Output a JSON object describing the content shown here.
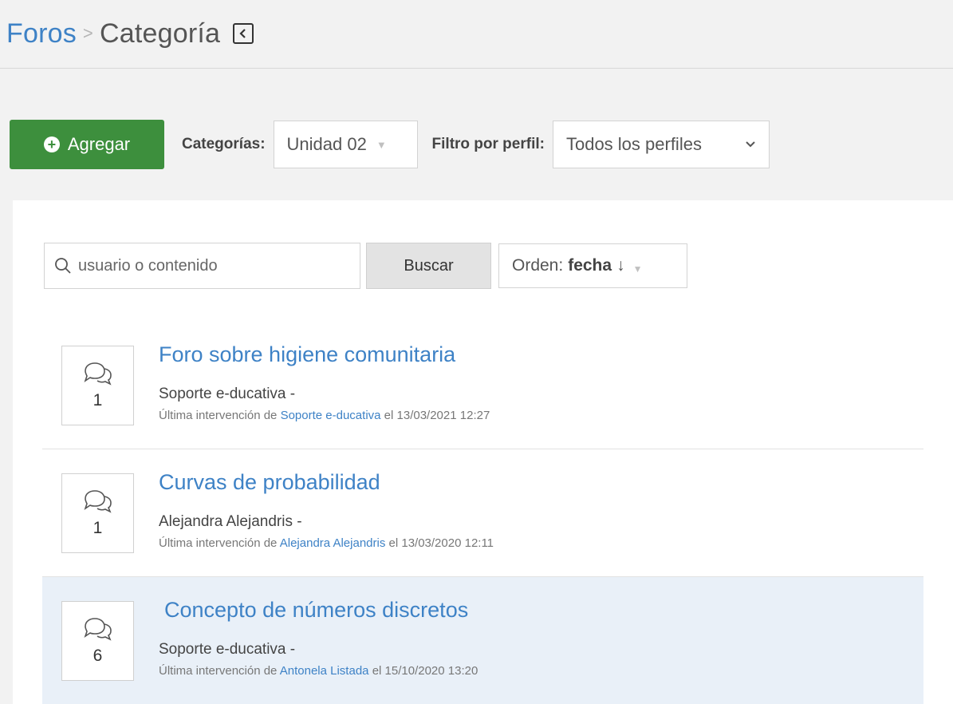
{
  "breadcrumb": {
    "root": "Foros",
    "separator": ">",
    "current": "Categoría",
    "collapse_icon": "chevron-left-icon"
  },
  "toolbar": {
    "add_label": "Agregar",
    "categories_label": "Categorías:",
    "categories_value": "Unidad 02",
    "profile_filter_label": "Filtro por perfil:",
    "profile_filter_value": "Todos los perfiles"
  },
  "search": {
    "placeholder": "usuario o contenido",
    "button_label": "Buscar",
    "order_prefix": "Orden:",
    "order_value": "fecha",
    "order_arrow": "↓"
  },
  "forums": [
    {
      "title": "Foro sobre higiene comunitaria",
      "author": "Soporte e-ducativa -",
      "last_prefix": "Última intervención de",
      "last_user": "Soporte e-ducativa",
      "last_date": "el 13/03/2021 12:27",
      "count": "1",
      "highlighted": false
    },
    {
      "title": "Curvas de probabilidad",
      "author": "Alejandra Alejandris -",
      "last_prefix": "Última intervención de",
      "last_user": "Alejandra Alejandris",
      "last_date": "el 13/03/2020 12:11",
      "count": "1",
      "highlighted": false
    },
    {
      "title": "Concepto de números discretos",
      "author": "Soporte e-ducativa -",
      "last_prefix": "Última intervención de",
      "last_user": "Antonela Listada",
      "last_date": "el 15/10/2020 13:20",
      "count": "6",
      "highlighted": true
    }
  ],
  "colors": {
    "link": "#3e82c6",
    "add_button": "#3d8f3d",
    "highlight_row": "#e9f0f8",
    "page_bg": "#f2f2f2"
  }
}
